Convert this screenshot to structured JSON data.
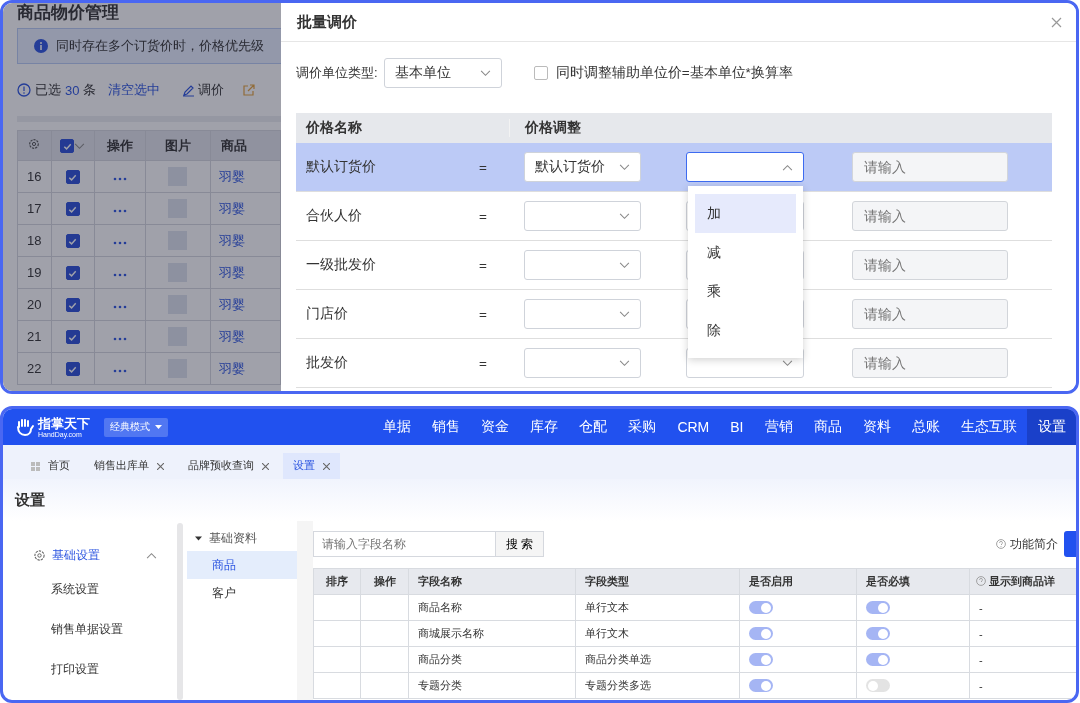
{
  "background_page": {
    "title": "商品物价管理",
    "notice": "同时存在多个订货价时，价格优先级",
    "selection": {
      "prefix": "已选",
      "count": "30",
      "suffix": "条",
      "clear_link": "清空选中"
    },
    "adjust_button": "调价",
    "table": {
      "columns": [
        "操作",
        "图片",
        "商品"
      ],
      "header_checked": true,
      "rows": [
        {
          "index": "16",
          "checked": true,
          "product": "羽婴"
        },
        {
          "index": "17",
          "checked": true,
          "product": "羽婴"
        },
        {
          "index": "18",
          "checked": true,
          "product": "羽婴"
        },
        {
          "index": "19",
          "checked": true,
          "product": "羽婴"
        },
        {
          "index": "20",
          "checked": true,
          "product": "羽婴"
        },
        {
          "index": "21",
          "checked": true,
          "product": "羽婴"
        },
        {
          "index": "22",
          "checked": true,
          "product": "羽婴"
        }
      ]
    }
  },
  "dialog": {
    "title": "批量调价",
    "unit_type_label": "调价单位类型:",
    "unit_type_value": "基本单位",
    "sync_checkbox": {
      "label": "同时调整辅助单位价=基本单位*换算率",
      "checked": false
    },
    "columns": [
      "价格名称",
      "价格调整"
    ],
    "rows": [
      {
        "name": "默认订货价",
        "selected": true,
        "equals": "=",
        "base_value": "默认订货价",
        "operator_open": true,
        "amount_placeholder": "请输入"
      },
      {
        "name": "合伙人价",
        "selected": false,
        "equals": "=",
        "operator_open": false,
        "amount_placeholder": "请输入"
      },
      {
        "name": "一级批发价",
        "selected": false,
        "equals": "=",
        "operator_open": false,
        "amount_placeholder": "请输入"
      },
      {
        "name": "门店价",
        "selected": false,
        "equals": "=",
        "operator_open": false,
        "amount_placeholder": "请输入"
      },
      {
        "name": "批发价",
        "selected": false,
        "equals": "=",
        "operator_open": false,
        "amount_placeholder": "请输入"
      }
    ],
    "operator_options": [
      {
        "label": "加",
        "selected": true
      },
      {
        "label": "减",
        "selected": false
      },
      {
        "label": "乘",
        "selected": false
      },
      {
        "label": "除",
        "selected": false
      }
    ]
  },
  "app": {
    "brand": "指掌天下",
    "brand_sub": "HandDay.com",
    "mode_button": "经典模式",
    "nav": [
      {
        "label": "单据",
        "selected": false
      },
      {
        "label": "销售",
        "selected": false
      },
      {
        "label": "资金",
        "selected": false
      },
      {
        "label": "库存",
        "selected": false
      },
      {
        "label": "仓配",
        "selected": false
      },
      {
        "label": "采购",
        "selected": false
      },
      {
        "label": "CRM",
        "selected": false
      },
      {
        "label": "BI",
        "selected": false
      },
      {
        "label": "营销",
        "selected": false
      },
      {
        "label": "商品",
        "selected": false
      },
      {
        "label": "资料",
        "selected": false
      },
      {
        "label": "总账",
        "selected": false
      },
      {
        "label": "生态互联",
        "selected": false
      },
      {
        "label": "设置",
        "selected": true
      }
    ],
    "tabs": [
      {
        "label": "首页",
        "kind": "home",
        "selected": false
      },
      {
        "label": "销售出库单",
        "kind": "page",
        "selected": false
      },
      {
        "label": "品牌预收查询",
        "kind": "page",
        "selected": false
      },
      {
        "label": "设置",
        "kind": "page",
        "selected": true
      }
    ],
    "page_title": "设置",
    "sidebar": [
      {
        "label": "基础设置",
        "selected": true,
        "expanded": true,
        "children": [
          {
            "label": "系统设置",
            "selected": false
          },
          {
            "label": "销售单据设置",
            "selected": false
          },
          {
            "label": "打印设置",
            "selected": false
          }
        ]
      }
    ],
    "tree": [
      {
        "label": "基础资料",
        "expanded": true,
        "children": [
          {
            "label": "商品",
            "selected": true
          },
          {
            "label": "客户",
            "selected": false
          }
        ]
      }
    ],
    "search": {
      "placeholder": "请输入字段名称",
      "button": "搜 索"
    },
    "help_link": "功能简介",
    "fields_table": {
      "columns": [
        "排序",
        "操作",
        "字段名称",
        "字段类型",
        "是否启用",
        "是否必填",
        "显示到商品详"
      ],
      "rows": [
        {
          "name": "商品名称",
          "type": "单行文本",
          "enabled": true,
          "required": true,
          "detail": "-"
        },
        {
          "name": "商城展示名称",
          "type": "单行文木",
          "enabled": true,
          "required": true,
          "detail": "-"
        },
        {
          "name": "商品分类",
          "type": "商品分类单选",
          "enabled": true,
          "required": true,
          "detail": "-"
        },
        {
          "name": "专题分类",
          "type": "专题分类多选",
          "enabled": true,
          "required": false,
          "detail": "-"
        }
      ]
    }
  }
}
